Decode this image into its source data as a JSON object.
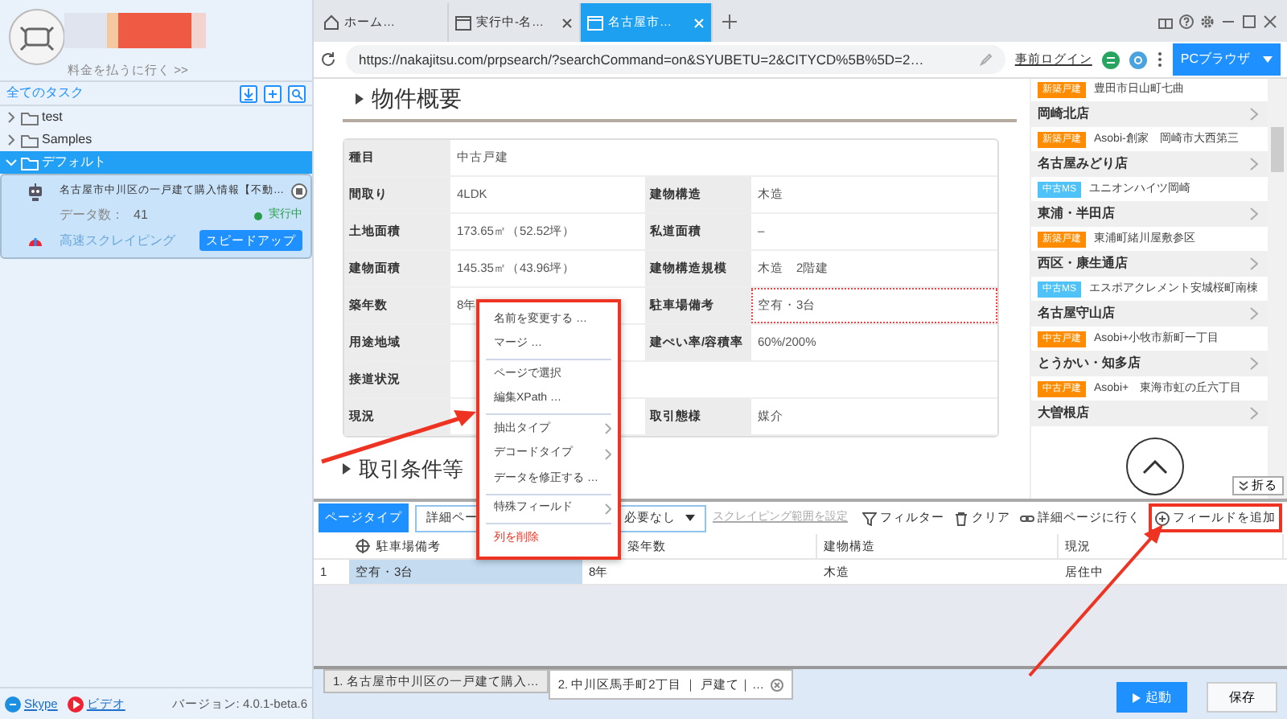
{
  "sidebar": {
    "upgrade_link": "料金を払うに行く >>",
    "all_tasks": "全てのタスク",
    "tree": [
      {
        "label": "test",
        "expanded": false,
        "selected": false
      },
      {
        "label": "Samples",
        "expanded": false,
        "selected": false
      },
      {
        "label": "デフォルト",
        "expanded": true,
        "selected": true,
        "children": [
          {
            "title": "名古屋市中川区の一戸建て購入情報【不動…",
            "data_label": "データ数：",
            "data_count": "41",
            "status": "実行中",
            "mode": "高速スクレイピング",
            "action": "スピードアップ"
          }
        ]
      }
    ],
    "footer_links": [
      "Skype",
      "ビデオ"
    ],
    "version": "バージョン: 4.0.1-beta.6"
  },
  "browser_tabs": [
    {
      "kind": "home",
      "label": "ホーム…",
      "selected": false
    },
    {
      "kind": "page",
      "label": "実行中-名…",
      "selected": false
    },
    {
      "kind": "page",
      "label": "名古屋市…",
      "selected": true
    }
  ],
  "address_bar": {
    "url": "https://nakajitsu.com/prpsearch/?searchCommand=on&SYUBETU=2&CITYCD%5B%5D=2…",
    "prelogin": "事前ログイン",
    "mode_button": "PCブラウザ"
  },
  "page": {
    "section_title": "物件概要",
    "table": [
      [
        {
          "kind": "label",
          "text": "種目"
        },
        {
          "kind": "wide",
          "text": "中古戸建"
        }
      ],
      [
        {
          "kind": "label",
          "text": "間取り"
        },
        {
          "kind": "value",
          "text": "4LDK"
        },
        {
          "kind": "label",
          "text": "建物構造"
        },
        {
          "kind": "value",
          "text": "木造"
        }
      ],
      [
        {
          "kind": "label",
          "text": "土地面積"
        },
        {
          "kind": "value",
          "text": "173.65㎡（52.52坪）"
        },
        {
          "kind": "label",
          "text": "私道面積"
        },
        {
          "kind": "value",
          "text": "–"
        }
      ],
      [
        {
          "kind": "label",
          "text": "建物面積"
        },
        {
          "kind": "value",
          "text": "145.35㎡（43.96坪）"
        },
        {
          "kind": "label",
          "text": "建物構造規模"
        },
        {
          "kind": "value",
          "text": "木造　2階建"
        }
      ],
      [
        {
          "kind": "label",
          "text": "築年数"
        },
        {
          "kind": "value",
          "text": "8年"
        },
        {
          "kind": "label",
          "text": "駐車場備考"
        },
        {
          "kind": "picked",
          "text": "空有・3台"
        }
      ],
      [
        {
          "kind": "label",
          "text": "用途地域"
        },
        {
          "kind": "value"
        },
        {
          "kind": "label",
          "text": "建ぺい率/容積率"
        },
        {
          "kind": "value",
          "text": "60%/200%"
        }
      ],
      [
        {
          "kind": "label",
          "text": "接道状況"
        },
        {
          "kind": "wide"
        }
      ],
      [
        {
          "kind": "label",
          "text": "現況"
        },
        {
          "kind": "value"
        },
        {
          "kind": "label",
          "text": "取引態様"
        },
        {
          "kind": "value",
          "text": "媒介"
        }
      ]
    ],
    "next_section": "取引条件等"
  },
  "store_list": [
    {
      "kind": "listing",
      "badge": "新築戸建",
      "color": "#ff8c00",
      "text": "豊田市日山町七曲"
    },
    {
      "kind": "store",
      "text": "岡崎北店"
    },
    {
      "kind": "listing",
      "badge": "新築戸建",
      "color": "#ff8c00",
      "text": "Asobi-創家　岡崎市大西第三"
    },
    {
      "kind": "store",
      "text": "名古屋みどり店"
    },
    {
      "kind": "listing",
      "badge": "中古MS",
      "color": "#4fc3f7",
      "text": "ユニオンハイツ岡崎"
    },
    {
      "kind": "store",
      "text": "東浦・半田店"
    },
    {
      "kind": "listing",
      "badge": "新築戸建",
      "color": "#ff8c00",
      "text": "東浦町緒川屋敷参区"
    },
    {
      "kind": "store",
      "text": "西区・康生通店"
    },
    {
      "kind": "listing",
      "badge": "中古MS",
      "color": "#4fc3f7",
      "text": "エスポアクレメント安城桜町南棟"
    },
    {
      "kind": "store",
      "text": "名古屋守山店"
    },
    {
      "kind": "listing",
      "badge": "中古戸建",
      "color": "#ff8c00",
      "text": "Asobi+小牧市新町一丁目"
    },
    {
      "kind": "store",
      "text": "とうかい・知多店"
    },
    {
      "kind": "listing",
      "badge": "中古戸建",
      "color": "#ff8c00",
      "text": "Asobi+　東海市虹の丘六丁目"
    },
    {
      "kind": "store",
      "text": "大曽根店"
    }
  ],
  "collapse_button": "折る",
  "context_menu": [
    {
      "kind": "item",
      "label": "名前を変更する …",
      "submenu": false
    },
    {
      "kind": "item",
      "label": "マージ …",
      "submenu": false
    },
    {
      "kind": "divider"
    },
    {
      "kind": "item",
      "label": "ページで選択",
      "submenu": false
    },
    {
      "kind": "item",
      "label": "編集XPath …",
      "submenu": false
    },
    {
      "kind": "divider"
    },
    {
      "kind": "item",
      "label": "抽出タイプ",
      "submenu": true
    },
    {
      "kind": "item",
      "label": "デコードタイプ",
      "submenu": true
    },
    {
      "kind": "item",
      "label": "データを修正する …",
      "submenu": false
    },
    {
      "kind": "divider"
    },
    {
      "kind": "item",
      "label": "特殊フィールド",
      "submenu": true
    },
    {
      "kind": "divider"
    },
    {
      "kind": "danger",
      "label": "列を削除",
      "submenu": false
    }
  ],
  "toolbar": {
    "page_type_label": "ページタイプ",
    "page_type_value": "詳細ペー",
    "second_select": "必要なし",
    "range_link": "スクレイピング範囲を設定",
    "actions": [
      {
        "kind": "filter",
        "label": "フィルター"
      },
      {
        "kind": "clear",
        "label": "クリア"
      },
      {
        "kind": "link",
        "label": "詳細ページに行く"
      },
      {
        "kind": "add",
        "label": "フィールドを追加"
      }
    ]
  },
  "grid": {
    "columns": [
      {
        "label": "駐車場備考",
        "target": true
      },
      {
        "label": "築年数",
        "target": false
      },
      {
        "label": "建物構造",
        "target": false
      },
      {
        "label": "現況",
        "target": false
      }
    ],
    "rows": [
      {
        "index": "1",
        "cells": [
          {
            "text": "空有・3台",
            "selected": true
          },
          {
            "text": "8年",
            "selected": false
          },
          {
            "text": "木造",
            "selected": false
          },
          {
            "text": "居住中",
            "selected": false
          }
        ]
      }
    ]
  },
  "task_tabs": [
    {
      "label": "1. 名古屋市中川区の一戸建て購入…",
      "selected": false,
      "closable": false
    },
    {
      "label": "2. 中川区馬手町2丁目 ｜ 戸建て｜…",
      "selected": true,
      "closable": true
    }
  ],
  "actions": {
    "start": "起動",
    "save": "保存"
  }
}
